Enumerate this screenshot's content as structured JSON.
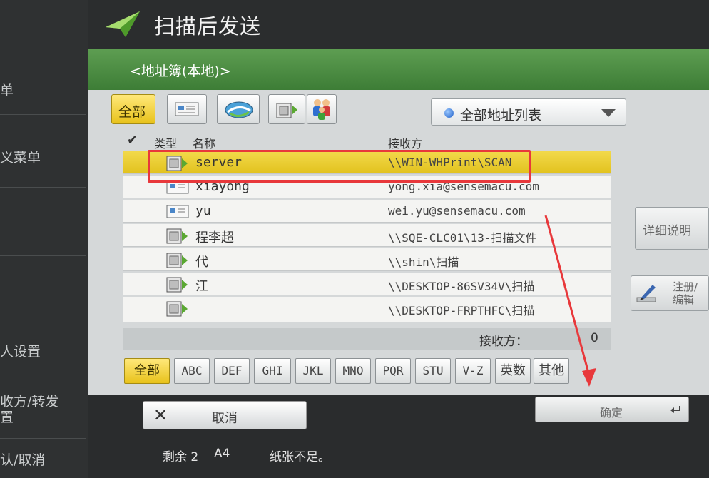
{
  "header": {
    "title": "扫描后发送"
  },
  "side_menu": [
    "单",
    "义菜单",
    "人设置",
    "收方/转发",
    "置",
    "认/取消"
  ],
  "panel": {
    "title": "<地址簿(本地)>",
    "type_filters": [
      {
        "label": "全部",
        "active": true,
        "icon": ""
      },
      {
        "label": "",
        "active": false,
        "icon": "email-card-icon"
      },
      {
        "label": "",
        "active": false,
        "icon": "globe-icon"
      },
      {
        "label": "",
        "active": false,
        "icon": "folder-icon"
      },
      {
        "label": "",
        "active": false,
        "icon": "group-icon"
      }
    ],
    "dropdown": {
      "label": "全部地址列表"
    },
    "list": {
      "headers": {
        "type": "类型",
        "name": "名称",
        "dest": "接收方"
      },
      "rows": [
        {
          "type": "folder",
          "name": "server",
          "dest": "\\\\WIN-WHPrint\\SCAN",
          "selected": true
        },
        {
          "type": "email",
          "name": "xiayong",
          "dest": "yong.xia@sensemacu.com",
          "selected": false
        },
        {
          "type": "email",
          "name": "yu",
          "dest": "wei.yu@sensemacu.com",
          "selected": false
        },
        {
          "type": "folder",
          "name": "程李超",
          "dest": "\\\\SQE-CLC01\\13-扫描文件",
          "selected": false
        },
        {
          "type": "folder",
          "name": "代",
          "dest": "\\\\shin\\扫描",
          "selected": false
        },
        {
          "type": "folder",
          "name": "江",
          "dest": "\\\\DESKTOP-86SV34V\\扫描",
          "selected": false
        },
        {
          "type": "folder",
          "name": "",
          "dest": "\\\\DESKTOP-FRPTHFC\\扫描",
          "selected": false
        }
      ],
      "count_label": "接收方：",
      "count_value": "0"
    },
    "buttons": {
      "details": "详细说明",
      "register_line1": "注册/",
      "register_line2": "编辑"
    },
    "alpha_filters": [
      "全部",
      "ABC",
      "DEF",
      "GHI",
      "JKL",
      "MNO",
      "PQR",
      "STU",
      "V-Z",
      "英数",
      "其他"
    ]
  },
  "bottom": {
    "cancel": "取消",
    "ok": "确定",
    "status_remaining": "剩余 2",
    "status_paper": "A4",
    "status_message": "纸张不足。"
  },
  "colors": {
    "selected_row": "#e8c91f",
    "green_bar": "#4a8a42",
    "highlight": "#e8383b"
  }
}
